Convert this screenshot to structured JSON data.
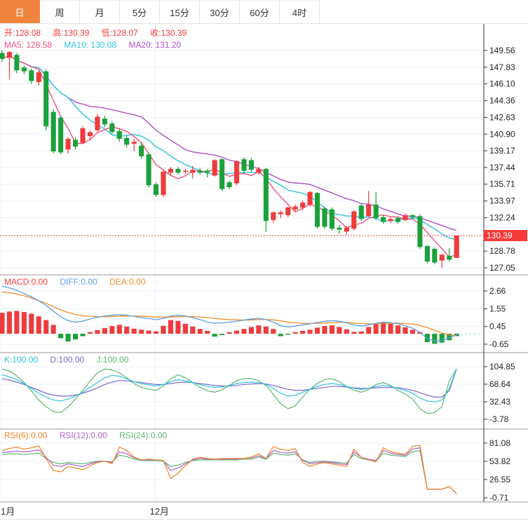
{
  "tabs": {
    "items": [
      {
        "label": "日",
        "active": true
      },
      {
        "label": "周",
        "active": false
      },
      {
        "label": "月",
        "active": false
      },
      {
        "label": "5分",
        "active": false
      },
      {
        "label": "15分",
        "active": false
      },
      {
        "label": "30分",
        "active": false
      },
      {
        "label": "60分",
        "active": false
      },
      {
        "label": "4时",
        "active": false
      }
    ]
  },
  "price_pane": {
    "ohlc_label": {
      "open": "开:128.08",
      "high": "高:130.39",
      "low": "低:128.07",
      "close": "收:130.39"
    },
    "ma_label": {
      "ma5": "MA5: 128.58",
      "ma10": "MA10: 130.08",
      "ma20": "MA20: 131.20"
    },
    "last_price_badge": "130.39",
    "y_ticks": [
      "149.56",
      "147.83",
      "146.10",
      "144.36",
      "142.63",
      "140.90",
      "139.17",
      "137.44",
      "135.71",
      "133.97",
      "132.24",
      "128.78",
      "127.05"
    ]
  },
  "macd_pane": {
    "label": {
      "macd": "MACD:0.00",
      "diff": "DIFF:0.00",
      "dea": "DEA:0.00"
    },
    "y_ticks": [
      "2.66",
      "1.55",
      "0.45",
      "-0.65"
    ]
  },
  "kdj_pane": {
    "label": {
      "k": "K:100.00",
      "d": "D:100.00",
      "j": "J:100.00"
    },
    "y_ticks": [
      "104.85",
      "68.64",
      "32.43",
      "-3.78"
    ]
  },
  "rsi_pane": {
    "label": {
      "rsi6": "RSI(6):0.00",
      "rsi12": "RSI(12):0.00",
      "rsi24": "RSI(24):0.00"
    },
    "y_ticks": [
      "81.08",
      "53.82",
      "26.55",
      "-0.71"
    ]
  },
  "x_axis": {
    "labels": [
      {
        "text": "1月",
        "x": 2
      },
      {
        "text": "12月",
        "x": 222
      }
    ]
  },
  "colors": {
    "up": "#ef3b3c",
    "down": "#1ba13a",
    "tab_accent": "#f0843d",
    "ma5": "#ef537c",
    "ma10": "#2fc3de",
    "ma20": "#b052c8",
    "diff": "#5aa0e6",
    "dea": "#f08c28",
    "k": "#2fc3de",
    "d": "#7d68c8",
    "j": "#5cb86e",
    "rsi6": "#f08428",
    "rsi12": "#b460c8",
    "rsi24": "#5cb86e",
    "grid": "#e9f2fb",
    "axis": "#555",
    "frame": "#333",
    "price_line": "#f53b3b",
    "badge_bg": "#f53b3b",
    "tick_text": "#222"
  },
  "chart_data": {
    "type": "candlestick",
    "title": "",
    "last_price": 130.39,
    "price_axis_ticks": [
      149.56,
      147.83,
      146.1,
      144.36,
      142.63,
      140.9,
      139.17,
      137.44,
      135.71,
      133.97,
      132.24,
      128.78,
      127.05
    ],
    "candles_ohlc": [
      [
        149.3,
        149.6,
        148.4,
        148.7
      ],
      [
        148.8,
        149.5,
        146.6,
        149.4
      ],
      [
        149.1,
        149.3,
        147.2,
        147.5
      ],
      [
        147.8,
        148.0,
        147.1,
        147.4
      ],
      [
        147.5,
        147.7,
        146.1,
        146.4
      ],
      [
        146.3,
        147.5,
        145.9,
        147.3
      ],
      [
        147.4,
        147.6,
        141.3,
        141.7
      ],
      [
        143.2,
        143.5,
        138.9,
        139.1
      ],
      [
        142.6,
        142.8,
        138.8,
        139.0
      ],
      [
        139.3,
        140.6,
        138.9,
        140.4
      ],
      [
        140.3,
        140.6,
        139.3,
        139.6
      ],
      [
        140.0,
        141.7,
        139.9,
        141.5
      ],
      [
        140.7,
        141.3,
        140.3,
        141.1
      ],
      [
        141.3,
        143.0,
        141.1,
        142.7
      ],
      [
        142.5,
        142.8,
        141.6,
        141.9
      ],
      [
        142.0,
        142.2,
        140.9,
        141.1
      ],
      [
        141.2,
        141.5,
        140.1,
        140.4
      ],
      [
        140.5,
        140.8,
        139.5,
        139.8
      ],
      [
        139.9,
        140.4,
        139.1,
        140.1
      ],
      [
        139.7,
        140.0,
        138.3,
        138.6
      ],
      [
        138.8,
        139.0,
        135.4,
        135.6
      ],
      [
        135.7,
        135.9,
        134.4,
        134.6
      ],
      [
        134.6,
        137.2,
        134.4,
        137.0
      ],
      [
        136.9,
        137.5,
        136.6,
        137.3
      ],
      [
        137.3,
        137.5,
        136.7,
        136.9
      ],
      [
        137.0,
        137.3,
        136.8,
        137.1
      ],
      [
        136.9,
        137.6,
        136.3,
        137.2
      ],
      [
        137.1,
        137.4,
        136.7,
        136.9
      ],
      [
        137.1,
        137.3,
        136.4,
        136.9
      ],
      [
        136.6,
        138.3,
        136.5,
        138.2
      ],
      [
        138.3,
        138.4,
        135.0,
        135.2
      ],
      [
        135.9,
        136.1,
        135.2,
        135.4
      ],
      [
        135.8,
        138.2,
        135.6,
        138.1
      ],
      [
        138.3,
        138.5,
        136.9,
        137.1
      ],
      [
        138.2,
        138.4,
        136.9,
        137.2
      ],
      [
        136.9,
        137.5,
        136.7,
        137.3
      ],
      [
        137.3,
        137.4,
        130.8,
        131.9
      ],
      [
        132.0,
        132.9,
        131.7,
        132.8
      ],
      [
        132.6,
        133.0,
        132.2,
        132.8
      ],
      [
        132.5,
        133.4,
        132.3,
        133.3
      ],
      [
        133.1,
        133.6,
        132.9,
        133.4
      ],
      [
        133.3,
        134.0,
        133.0,
        133.8
      ],
      [
        133.6,
        135.0,
        133.4,
        134.9
      ],
      [
        134.8,
        134.9,
        131.1,
        131.3
      ],
      [
        133.2,
        133.4,
        131.1,
        131.3
      ],
      [
        133.1,
        133.3,
        130.9,
        131.1
      ],
      [
        131.2,
        131.5,
        130.6,
        131.0
      ],
      [
        130.8,
        131.4,
        130.5,
        131.2
      ],
      [
        131.1,
        133.0,
        130.9,
        132.9
      ],
      [
        133.5,
        133.7,
        131.9,
        132.1
      ],
      [
        132.4,
        135.0,
        132.3,
        133.6
      ],
      [
        133.6,
        134.9,
        132.0,
        132.2
      ],
      [
        132.3,
        132.5,
        131.6,
        131.8
      ],
      [
        131.9,
        132.3,
        131.7,
        132.1
      ],
      [
        132.2,
        132.4,
        131.6,
        131.8
      ],
      [
        132.0,
        132.7,
        131.9,
        132.5
      ],
      [
        132.5,
        132.6,
        132.1,
        132.3
      ],
      [
        132.4,
        132.6,
        129.0,
        129.2
      ],
      [
        129.3,
        129.4,
        127.5,
        127.7
      ],
      [
        129.0,
        129.2,
        127.4,
        127.6
      ],
      [
        127.8,
        128.5,
        127.0,
        128.4
      ],
      [
        128.3,
        129.1,
        127.7,
        127.9
      ],
      [
        128.08,
        130.39,
        128.07,
        130.39
      ]
    ],
    "ma_current": {
      "ma5": 128.58,
      "ma10": 130.08,
      "ma20": 131.2
    },
    "macd": {
      "axis_ticks": [
        2.66,
        1.55,
        0.45,
        -0.65
      ],
      "hist": [
        1.3,
        1.38,
        1.42,
        1.35,
        1.25,
        1.08,
        0.85,
        0.55,
        -0.28,
        -0.48,
        -0.35,
        -0.15,
        0.1,
        0.22,
        0.35,
        0.48,
        0.55,
        0.45,
        0.32,
        0.25,
        0.2,
        0.15,
        0.5,
        0.85,
        0.8,
        0.62,
        0.45,
        0.3,
        0.18,
        -0.18,
        -0.08,
        0.1,
        0.2,
        0.3,
        0.42,
        0.52,
        0.45,
        0.3,
        -0.15,
        -0.06,
        0.1,
        0.18,
        0.25,
        0.38,
        0.48,
        0.52,
        0.42,
        0.28,
        0.12,
        0.15,
        0.42,
        0.6,
        0.7,
        0.62,
        0.52,
        0.4,
        0.25,
        0.1,
        -0.52,
        -0.62,
        -0.55,
        -0.4,
        -0.15
      ],
      "diff": [
        2.95,
        2.85,
        2.7,
        2.5,
        2.3,
        2.05,
        1.75,
        1.4,
        1.05,
        0.82,
        0.72,
        0.78,
        0.92,
        1.02,
        1.1,
        1.15,
        1.18,
        1.15,
        1.08,
        1.0,
        0.95,
        0.88,
        0.95,
        1.1,
        1.15,
        1.1,
        1.0,
        0.88,
        0.72,
        0.65,
        0.68,
        0.72,
        0.78,
        0.85,
        0.92,
        0.95,
        0.88,
        0.72,
        0.5,
        0.42,
        0.48,
        0.55,
        0.62,
        0.7,
        0.78,
        0.82,
        0.78,
        0.68,
        0.55,
        0.48,
        0.55,
        0.65,
        0.72,
        0.7,
        0.62,
        0.5,
        0.35,
        0.1,
        -0.3,
        -0.45,
        -0.42,
        -0.25,
        -0.05
      ],
      "dea": [
        2.6,
        2.55,
        2.47,
        2.36,
        2.22,
        2.06,
        1.88,
        1.68,
        1.48,
        1.32,
        1.2,
        1.12,
        1.08,
        1.06,
        1.06,
        1.07,
        1.09,
        1.1,
        1.1,
        1.09,
        1.07,
        1.04,
        1.03,
        1.04,
        1.06,
        1.07,
        1.06,
        1.04,
        1.0,
        0.95,
        0.91,
        0.88,
        0.86,
        0.85,
        0.86,
        0.88,
        0.88,
        0.86,
        0.8,
        0.73,
        0.68,
        0.65,
        0.64,
        0.65,
        0.67,
        0.7,
        0.71,
        0.7,
        0.67,
        0.63,
        0.62,
        0.62,
        0.64,
        0.66,
        0.66,
        0.64,
        0.6,
        0.52,
        0.38,
        0.22,
        0.05,
        -0.08,
        -0.12
      ]
    },
    "kdj": {
      "axis_ticks": [
        104.85,
        68.64,
        32.43,
        -3.78
      ],
      "k": [
        88,
        84,
        78,
        70,
        60,
        50,
        42,
        36,
        34,
        38,
        44,
        52,
        62,
        72,
        82,
        87,
        85,
        80,
        74,
        70,
        67,
        65,
        68,
        74,
        78,
        76,
        72,
        68,
        64,
        62,
        63,
        66,
        70,
        72,
        73,
        72,
        68,
        60,
        50,
        44,
        46,
        52,
        58,
        64,
        68,
        70,
        68,
        64,
        60,
        58,
        60,
        64,
        66,
        64,
        60,
        56,
        50,
        40,
        34,
        32,
        36,
        60,
        100
      ],
      "d": [
        80,
        77,
        73,
        68,
        62,
        56,
        50,
        46,
        44,
        44,
        46,
        50,
        55,
        61,
        68,
        73,
        76,
        76,
        74,
        72,
        70,
        68,
        68,
        70,
        72,
        73,
        72,
        70,
        68,
        66,
        65,
        65,
        66,
        68,
        69,
        70,
        69,
        66,
        62,
        58,
        56,
        56,
        58,
        60,
        62,
        64,
        64,
        63,
        61,
        60,
        60,
        61,
        62,
        62,
        61,
        59,
        56,
        51,
        46,
        42,
        42,
        55,
        100
      ],
      "j": [
        100,
        96,
        86,
        72,
        55,
        36,
        22,
        12,
        10,
        22,
        38,
        55,
        75,
        92,
        100,
        98,
        92,
        82,
        70,
        62,
        58,
        56,
        65,
        80,
        88,
        82,
        72,
        62,
        55,
        52,
        57,
        66,
        76,
        80,
        80,
        76,
        66,
        48,
        28,
        18,
        24,
        42,
        58,
        70,
        78,
        80,
        74,
        64,
        56,
        52,
        58,
        68,
        72,
        66,
        56,
        48,
        38,
        18,
        8,
        10,
        22,
        75,
        100
      ]
    },
    "rsi": {
      "axis_ticks": [
        81.08,
        53.82,
        26.55,
        -0.71
      ],
      "rsi6": [
        70,
        73,
        75,
        72,
        74,
        77,
        58,
        40,
        38,
        46,
        44,
        41,
        47,
        52,
        54,
        50,
        75,
        70,
        60,
        56,
        57,
        56,
        55,
        28,
        36,
        47,
        57,
        60,
        58,
        57,
        58,
        58,
        58,
        58,
        60,
        65,
        58,
        76,
        72,
        70,
        73,
        52,
        46,
        50,
        52,
        50,
        48,
        46,
        72,
        60,
        56,
        53,
        74,
        68,
        66,
        64,
        76,
        78,
        12,
        12,
        12,
        16,
        5
      ],
      "rsi12": [
        67,
        68,
        69,
        68,
        69,
        71,
        60,
        48,
        46,
        50,
        48,
        46,
        50,
        53,
        54,
        52,
        68,
        65,
        59,
        56,
        56,
        56,
        55,
        40,
        44,
        50,
        56,
        58,
        57,
        57,
        57,
        57,
        57,
        58,
        59,
        62,
        58,
        70,
        67,
        66,
        68,
        55,
        50,
        52,
        53,
        52,
        50,
        49,
        68,
        60,
        57,
        55,
        70,
        66,
        64,
        63,
        72,
        74,
        12,
        12,
        12,
        16,
        5
      ],
      "rsi24": [
        64,
        65,
        65,
        64,
        65,
        66,
        58,
        52,
        50,
        52,
        51,
        50,
        52,
        54,
        54,
        53,
        63,
        61,
        57,
        55,
        55,
        55,
        54,
        46,
        48,
        52,
        55,
        56,
        56,
        56,
        56,
        56,
        56,
        57,
        57,
        60,
        57,
        66,
        64,
        63,
        65,
        56,
        52,
        54,
        54,
        53,
        52,
        51,
        64,
        58,
        56,
        54,
        66,
        63,
        62,
        61,
        68,
        70,
        12,
        12,
        12,
        16,
        5
      ]
    },
    "x_labels": [
      {
        "text": "1月",
        "index": 0
      },
      {
        "text": "12月",
        "index": 21
      }
    ]
  }
}
